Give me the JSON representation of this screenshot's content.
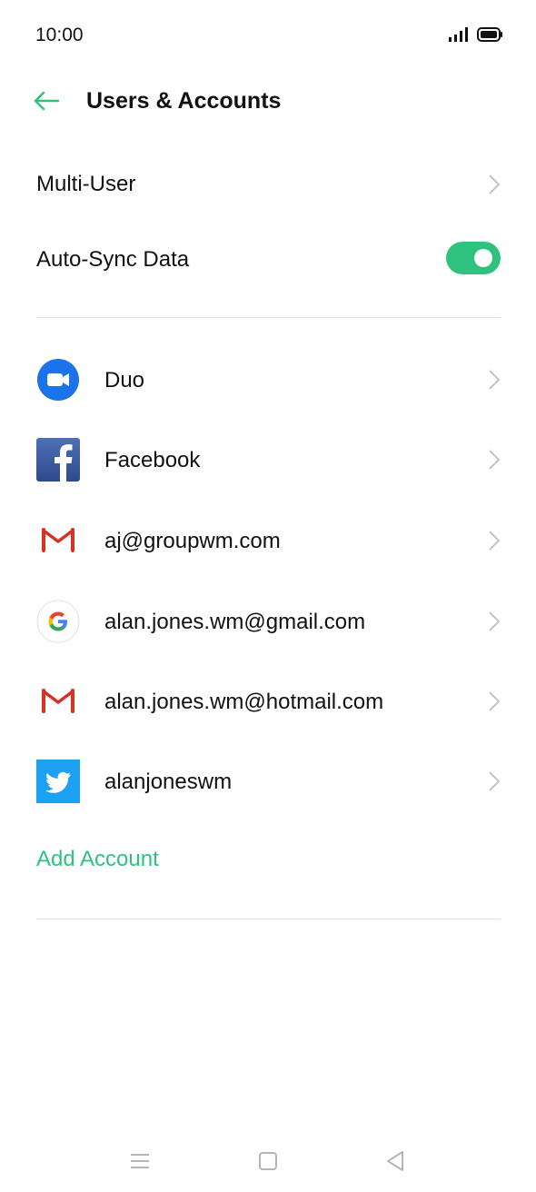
{
  "status_bar": {
    "time": "10:00"
  },
  "header": {
    "title": "Users & Accounts",
    "back_icon": "arrow-left-icon"
  },
  "settings": {
    "multi_user_label": "Multi-User",
    "auto_sync_label": "Auto-Sync Data",
    "auto_sync_enabled": true
  },
  "accounts": [
    {
      "label": "Duo",
      "icon": "duo-icon"
    },
    {
      "label": "Facebook",
      "icon": "facebook-icon"
    },
    {
      "label": "aj@groupwm.com",
      "icon": "gmail-icon"
    },
    {
      "label": "alan.jones.wm@gmail.com",
      "icon": "google-icon"
    },
    {
      "label": "alan.jones.wm@hotmail.com",
      "icon": "gmail-icon"
    },
    {
      "label": "alanjoneswm",
      "icon": "twitter-icon"
    }
  ],
  "add_account_label": "Add Account",
  "colors": {
    "accent": "#2ec27e",
    "duo": "#1a73e8",
    "facebook": "#3b5998",
    "gmail_red": "#d93025",
    "twitter": "#1da1f2"
  },
  "nav_bar": {
    "menu_icon": "menu-icon",
    "home_icon": "home-icon",
    "back_icon": "back-triangle-icon"
  }
}
